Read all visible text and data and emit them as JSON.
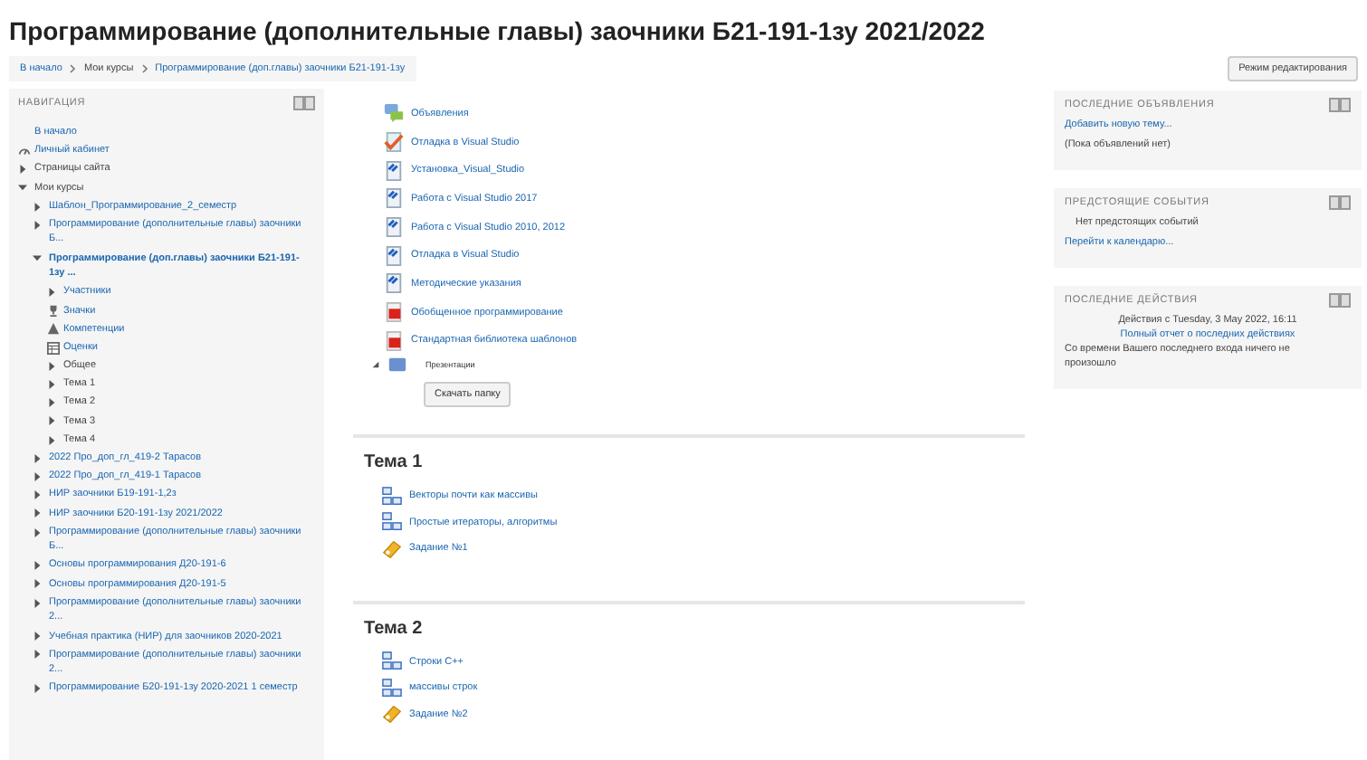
{
  "page_title": "Программирование (дополнительные главы) заочники Б21-191-1зу 2021/2022",
  "breadcrumb": [
    {
      "label": "В начало",
      "link": true
    },
    {
      "label": "Мои курсы",
      "link": false
    },
    {
      "label": "Программирование (доп.главы) заочники Б21-191-1зу",
      "link": true
    }
  ],
  "edit_button": "Режим редактирования",
  "navigation": {
    "title": "НАВИГАЦИЯ",
    "items": [
      {
        "label": "В начало",
        "kind": "leaf",
        "link": true
      },
      {
        "label": "Личный кабинет",
        "kind": "dashboard",
        "link": true
      },
      {
        "label": "Страницы сайта",
        "kind": "branch",
        "link": false,
        "expanded": false
      },
      {
        "label": "Мои курсы",
        "kind": "branch",
        "link": false,
        "expanded": true,
        "children": [
          {
            "label": "Шаблон_Программирование_2_семестр",
            "kind": "branch",
            "link": true,
            "expanded": false
          },
          {
            "label": "Программирование (дополнительные главы) заочники Б...",
            "kind": "branch",
            "link": true,
            "expanded": false
          },
          {
            "label": "Программирование (доп.главы) заочники Б21-191-1зу ...",
            "kind": "branch",
            "link": true,
            "expanded": true,
            "current": true,
            "children": [
              {
                "label": "Участники",
                "kind": "branch",
                "link": true,
                "expanded": false
              },
              {
                "label": "Значки",
                "kind": "badges",
                "link": true
              },
              {
                "label": "Компетенции",
                "kind": "competencies",
                "link": true
              },
              {
                "label": "Оценки",
                "kind": "grades",
                "link": true
              },
              {
                "label": "Общее",
                "kind": "branch",
                "link": false,
                "expanded": false
              },
              {
                "label": "Тема 1",
                "kind": "branch",
                "link": false,
                "expanded": false
              },
              {
                "label": "Тема 2",
                "kind": "branch",
                "link": false,
                "expanded": false
              },
              {
                "label": "Тема 3",
                "kind": "branch",
                "link": false,
                "expanded": false
              },
              {
                "label": "Тема 4",
                "kind": "branch",
                "link": false,
                "expanded": false
              }
            ]
          },
          {
            "label": "2022 Про_доп_гл_419-2 Тарасов",
            "kind": "branch",
            "link": true,
            "expanded": false
          },
          {
            "label": "2022 Про_доп_гл_419-1 Тарасов",
            "kind": "branch",
            "link": true,
            "expanded": false
          },
          {
            "label": "НИР заочники Б19-191-1,2з",
            "kind": "branch",
            "link": true,
            "expanded": false
          },
          {
            "label": "НИР заочники Б20-191-1зу 2021/2022",
            "kind": "branch",
            "link": true,
            "expanded": false
          },
          {
            "label": "Программирование (дополнительные главы) заочники Б...",
            "kind": "branch",
            "link": true,
            "expanded": false
          },
          {
            "label": "Основы программирования Д20-191-6",
            "kind": "branch",
            "link": true,
            "expanded": false
          },
          {
            "label": "Основы программирования Д20-191-5",
            "kind": "branch",
            "link": true,
            "expanded": false
          },
          {
            "label": "Программирование (дополнительные главы) заочники 2...",
            "kind": "branch",
            "link": true,
            "expanded": false
          },
          {
            "label": "Учебная практика (НИР) для заочников 2020-2021",
            "kind": "branch",
            "link": true,
            "expanded": false
          },
          {
            "label": "Программирование (дополнительные главы) заочники 2...",
            "kind": "branch",
            "link": true,
            "expanded": false
          },
          {
            "label": "Программирование Б20-191-1зу 2020-2021 1 семестр",
            "kind": "branch",
            "link": true,
            "expanded": false
          }
        ]
      }
    ]
  },
  "general_section": {
    "activities": [
      {
        "label": "Объявления",
        "kind": "forum"
      },
      {
        "label": "Отладка в Visual Studio",
        "kind": "assignment-check"
      },
      {
        "label": "Установка_Visual_Studio",
        "kind": "document"
      },
      {
        "label": "Работа с Visual Studio 2017",
        "kind": "document"
      },
      {
        "label": "Работа с Visual Studio 2010, 2012",
        "kind": "document"
      },
      {
        "label": "Отладка в Visual Studio",
        "kind": "document"
      },
      {
        "label": "Методические указания",
        "kind": "document"
      },
      {
        "label": "Обобщенное программирование",
        "kind": "pdf"
      },
      {
        "label": "Стандартная библиотека шаблонов",
        "kind": "pdf"
      }
    ],
    "folder": {
      "label": "Презентации",
      "expanded": false,
      "button": "Скачать папку"
    }
  },
  "sections": [
    {
      "title": "Тема 1",
      "activities": [
        {
          "label": "Векторы почти как массивы",
          "kind": "page"
        },
        {
          "label": "Простые итераторы, алгоритмы",
          "kind": "page"
        },
        {
          "label": "Задание №1",
          "kind": "assignment"
        }
      ]
    },
    {
      "title": "Тема 2",
      "activities": [
        {
          "label": "Строки С++",
          "kind": "page"
        },
        {
          "label": "массивы строк",
          "kind": "page"
        },
        {
          "label": "Задание №2",
          "kind": "assignment"
        }
      ]
    }
  ],
  "blocks": [
    {
      "title": "ПОСЛЕДНИЕ ОБЪЯВЛЕНИЯ",
      "lines": [
        {
          "text": "Добавить новую тему...",
          "link": true,
          "kind": "body"
        },
        {
          "text": "(Пока объявлений нет)",
          "link": false,
          "kind": "body"
        }
      ]
    },
    {
      "title": "ПРЕДСТОЯЩИЕ СОБЫТИЯ",
      "lines": [
        {
          "text": "Нет предстоящих событий",
          "link": false,
          "kind": "note"
        },
        {
          "text": "Перейти к календарю...",
          "link": true,
          "kind": "body"
        }
      ]
    },
    {
      "title": "ПОСЛЕДНИЕ ДЕЙСТВИЯ",
      "lines": [
        {
          "text": "Действия с Tuesday, 3 May 2022, 16:11",
          "link": false,
          "kind": "summary"
        },
        {
          "text": "Полный отчет о последних действиях",
          "link": true,
          "kind": "summary"
        },
        {
          "text": "Со времени Вашего последнего входа ничего не произошло",
          "link": false,
          "kind": "body"
        }
      ]
    }
  ]
}
